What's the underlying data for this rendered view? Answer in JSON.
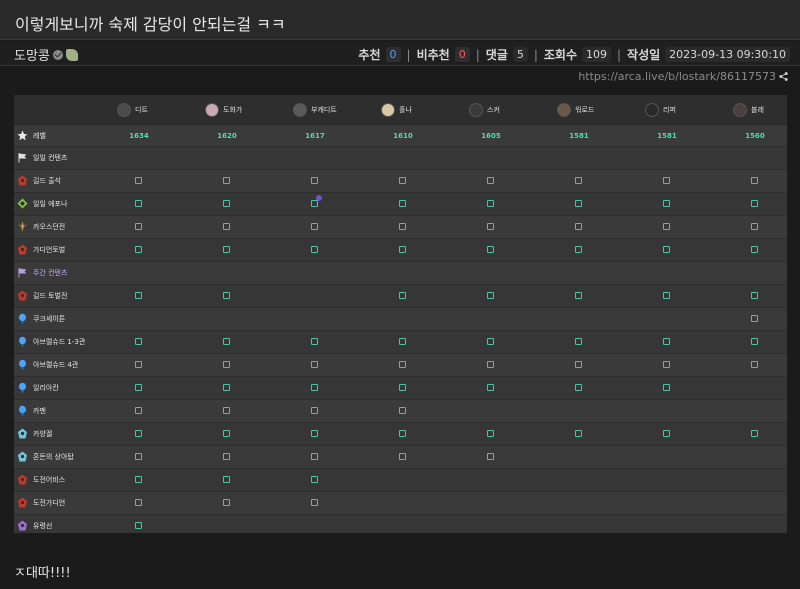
{
  "post": {
    "title": "이렇게보니까 숙제 감당이 안되는걸 ㅋㅋ",
    "author": "도망콩",
    "stats": {
      "upvote_label": "추천",
      "upvote_value": "0",
      "downvote_label": "비추천",
      "downvote_value": "0",
      "comments_label": "댓글",
      "comments_value": "5",
      "views_label": "조회수",
      "views_value": "109",
      "date_label": "작성일",
      "date_value": "2023-09-13 09:30:10"
    },
    "url": "https://arca.live/b/lostark/86117573",
    "comment_text": "ㅈ대따!!!!"
  },
  "sheet": {
    "characters": [
      {
        "name": "디트",
        "level": "1634",
        "avatar_color": "#4a4a4a"
      },
      {
        "name": "도화가",
        "level": "1620",
        "avatar_color": "#c9a9b5"
      },
      {
        "name": "부캐디트",
        "level": "1617",
        "avatar_color": "#5a5a5a"
      },
      {
        "name": "홀나",
        "level": "1610",
        "avatar_color": "#d9c8a8"
      },
      {
        "name": "스커",
        "level": "1605",
        "avatar_color": "#3a3a3a"
      },
      {
        "name": "워로드",
        "level": "1581",
        "avatar_color": "#6a5a4a"
      },
      {
        "name": "리퍼",
        "level": "1581",
        "avatar_color": "#2a2a2a"
      },
      {
        "name": "블레",
        "level": "1560",
        "avatar_color": "#4a4040"
      }
    ],
    "level_row_label": "레벨",
    "rows": [
      {
        "label": "일일 컨텐츠",
        "icon": "flag-icon",
        "icon_color": "#e0e0e0",
        "checks": [
          0,
          0,
          0,
          0,
          0,
          0,
          0,
          0
        ]
      },
      {
        "label": "길드 출석",
        "icon": "guild-icon",
        "icon_color": "#c0392b",
        "checks": [
          1,
          1,
          1,
          1,
          1,
          1,
          1,
          1
        ]
      },
      {
        "label": "일일 에포나",
        "icon": "epona-icon",
        "icon_color": "#8bc34a",
        "checks": [
          1,
          1,
          1,
          1,
          1,
          1,
          1,
          1
        ],
        "badge_col": 2
      },
      {
        "label": "카오스던전",
        "icon": "chaos-icon",
        "icon_color": "#b89a4a",
        "checks": [
          1,
          1,
          1,
          1,
          1,
          1,
          1,
          1
        ]
      },
      {
        "label": "가디언토벌",
        "icon": "guardian-icon",
        "icon_color": "#c0392b",
        "checks": [
          1,
          1,
          1,
          1,
          1,
          1,
          1,
          1
        ]
      },
      {
        "label": "주간 컨텐츠",
        "icon": "flag-icon",
        "icon_color": "#b39ddb",
        "checks": [
          0,
          0,
          0,
          0,
          0,
          0,
          0,
          0
        ],
        "purple": true
      },
      {
        "label": "길드 토벌전",
        "icon": "guild-icon",
        "icon_color": "#c0392b",
        "checks": [
          1,
          1,
          0,
          1,
          1,
          1,
          1,
          1
        ]
      },
      {
        "label": "쿠크세이튼",
        "icon": "raid-icon",
        "icon_color": "#4aa3ff",
        "checks": [
          0,
          0,
          0,
          0,
          0,
          0,
          0,
          1
        ]
      },
      {
        "label": "아브렐슈드 1-3관",
        "icon": "raid-icon",
        "icon_color": "#4aa3ff",
        "checks": [
          1,
          1,
          1,
          1,
          1,
          1,
          1,
          1
        ]
      },
      {
        "label": "아브렐슈드 4관",
        "icon": "raid-icon",
        "icon_color": "#4aa3ff",
        "checks": [
          1,
          1,
          1,
          1,
          1,
          1,
          1,
          1
        ]
      },
      {
        "label": "일리아칸",
        "icon": "raid-icon",
        "icon_color": "#4aa3ff",
        "checks": [
          1,
          1,
          1,
          1,
          1,
          1,
          1,
          0
        ]
      },
      {
        "label": "카멘",
        "icon": "raid-icon",
        "icon_color": "#4aa3ff",
        "checks": [
          1,
          1,
          1,
          1,
          0,
          0,
          0,
          0
        ]
      },
      {
        "label": "카양겔",
        "icon": "kayangel-icon",
        "icon_color": "#6ec6d8",
        "checks": [
          1,
          1,
          1,
          1,
          1,
          1,
          1,
          1
        ]
      },
      {
        "label": "혼돈의 상아탑",
        "icon": "tower-icon",
        "icon_color": "#6ec6d8",
        "checks": [
          1,
          1,
          1,
          1,
          1,
          0,
          0,
          0
        ]
      },
      {
        "label": "도전어비스",
        "icon": "abyss-icon",
        "icon_color": "#c0392b",
        "checks": [
          1,
          1,
          1,
          0,
          0,
          0,
          0,
          0
        ]
      },
      {
        "label": "도전가디언",
        "icon": "guardian-icon",
        "icon_color": "#c0392b",
        "checks": [
          1,
          1,
          1,
          0,
          0,
          0,
          0,
          0
        ]
      },
      {
        "label": "유령선",
        "icon": "ghostship-icon",
        "icon_color": "#9c6fd0",
        "checks": [
          1,
          0,
          0,
          0,
          0,
          0,
          0,
          0
        ]
      }
    ]
  }
}
